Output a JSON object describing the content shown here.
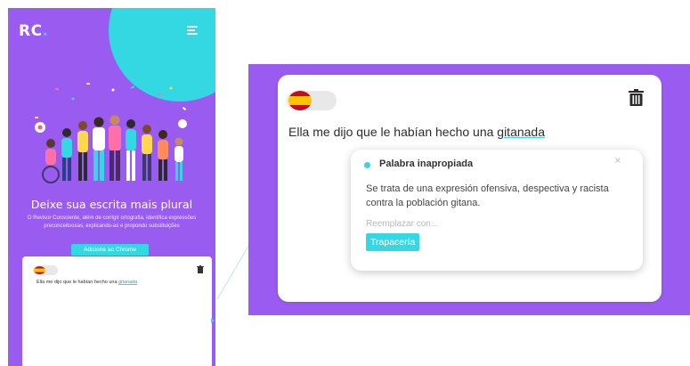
{
  "phone": {
    "logo_text": "RC",
    "logo_dot": ".",
    "menu_icon": "menu-icon",
    "illustration": "diverse-people-celebrating",
    "hero_title": "Deixe sua escrita mais plural",
    "hero_description": "O Revisor Consciente, além de corrigir ortografia, identifica expressões preconceituosas, explicando-as e propondo substituições",
    "cta_label": "Adicione ao Chrome",
    "preview": {
      "flag_icon": "spain-flag-icon",
      "text_before": "Ella me dijo que le habían hecho una ",
      "flagged_word": "gitanada"
    }
  },
  "zoom": {
    "flag_icon": "spain-flag-icon",
    "trash_icon": "trash-icon",
    "text_before": "Ella me dijo que le habían hecho una ",
    "flagged_word": "gitanada",
    "popup": {
      "title": "Palabra inapropiada",
      "close_label": "×",
      "description": "Se trata de una expresión ofensiva, despectiva y racista contra la población gitana.",
      "replace_label": "Reemplazar con...",
      "suggestion": "Trapacería"
    }
  },
  "colors": {
    "purple": "#9a5cf0",
    "cyan": "#34d8e3",
    "white": "#ffffff"
  }
}
